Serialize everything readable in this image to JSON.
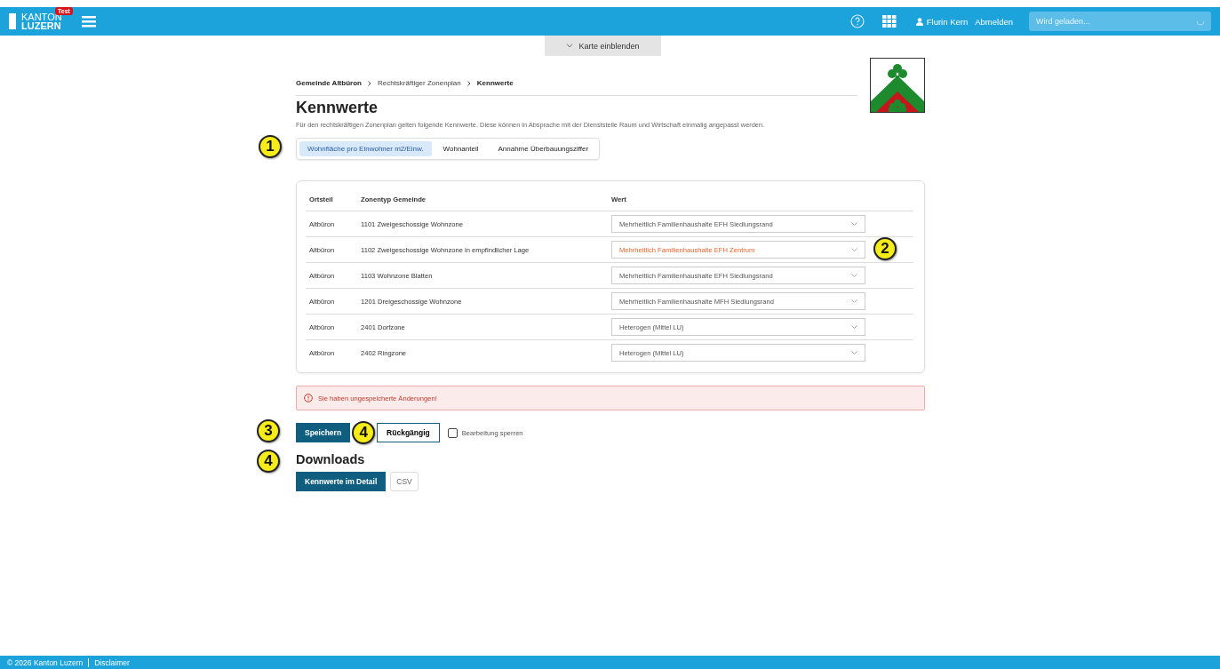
{
  "header": {
    "logo_line_1": "KANTON",
    "logo_line_2": "LUZERN",
    "env_badge": "Test",
    "user": "Flurin Kern",
    "logout": "Abmelden",
    "search": {
      "placeholder": "Wird geladen..."
    }
  },
  "map_toggle": {
    "label": "Karte einblenden",
    "expanded": false
  },
  "breadcrumb": [
    "Gemeinde Altbüron",
    "Rechtskräftiger Zonenplan",
    "Kennwerte"
  ],
  "title": "Kennwerte",
  "intro": "Für den rechtskräftigen Zonenplan gelten folgende Kennwerte. Diese können in Absprache mit der Dienststelle Raum und Wirtschaft einmalig angepasst werden.",
  "tabs": [
    {
      "label": "Wohnfläche pro Einwohner m2/Einw.",
      "selected": true
    },
    {
      "label": "Wohnanteil",
      "selected": false
    },
    {
      "label": "Annahme Überbauungsziffer",
      "selected": false
    }
  ],
  "table": {
    "columns": [
      "Ortsteil",
      "Zonentyp Gemeinde",
      "Wert"
    ],
    "rows": [
      {
        "ortsteil": "Altbüron",
        "zonentyp": "1101 Zweigeschossige Wohnzone",
        "wert": "Mehrheitlich Familienhaushalte EFH Siedlungsrand",
        "modified": false
      },
      {
        "ortsteil": "Altbüron",
        "zonentyp": "1102 Zweigeschossige Wohnzone in empfindlicher Lage",
        "wert": "Mehrheitlich Familienhaushalte EFH Zentrum",
        "modified": true
      },
      {
        "ortsteil": "Altbüron",
        "zonentyp": "1103 Wohnzone Blatten",
        "wert": "Mehrheitlich Familienhaushalte EFH Siedlungsrand",
        "modified": false
      },
      {
        "ortsteil": "Altbüron",
        "zonentyp": "1201 Dreigeschossige Wohnzone",
        "wert": "Mehrheitlich Familienhaushalte MFH Siedlungsrand",
        "modified": false
      },
      {
        "ortsteil": "Altbüron",
        "zonentyp": "2401 Dorfzone",
        "wert": "Heterogen (Mittel LU)",
        "modified": false
      },
      {
        "ortsteil": "Altbüron",
        "zonentyp": "2402 Ringzone",
        "wert": "Heterogen (Mittel LU)",
        "modified": false
      }
    ]
  },
  "warning": "Sie haben ungespeicherte Änderungen!",
  "actions": {
    "save": "Speichern",
    "undo": "Rückgängig",
    "lock": {
      "label": "Bearbeitung sperren",
      "checked": false
    }
  },
  "downloads": {
    "title": "Downloads",
    "buttons": [
      "Kennwerte im Detail",
      "CSV"
    ]
  },
  "callouts": [
    "1",
    "2",
    "3",
    "4",
    "4"
  ],
  "footer": {
    "copyright": "© 2026 Kanton Luzern",
    "disclaimer": "Disclaimer"
  }
}
